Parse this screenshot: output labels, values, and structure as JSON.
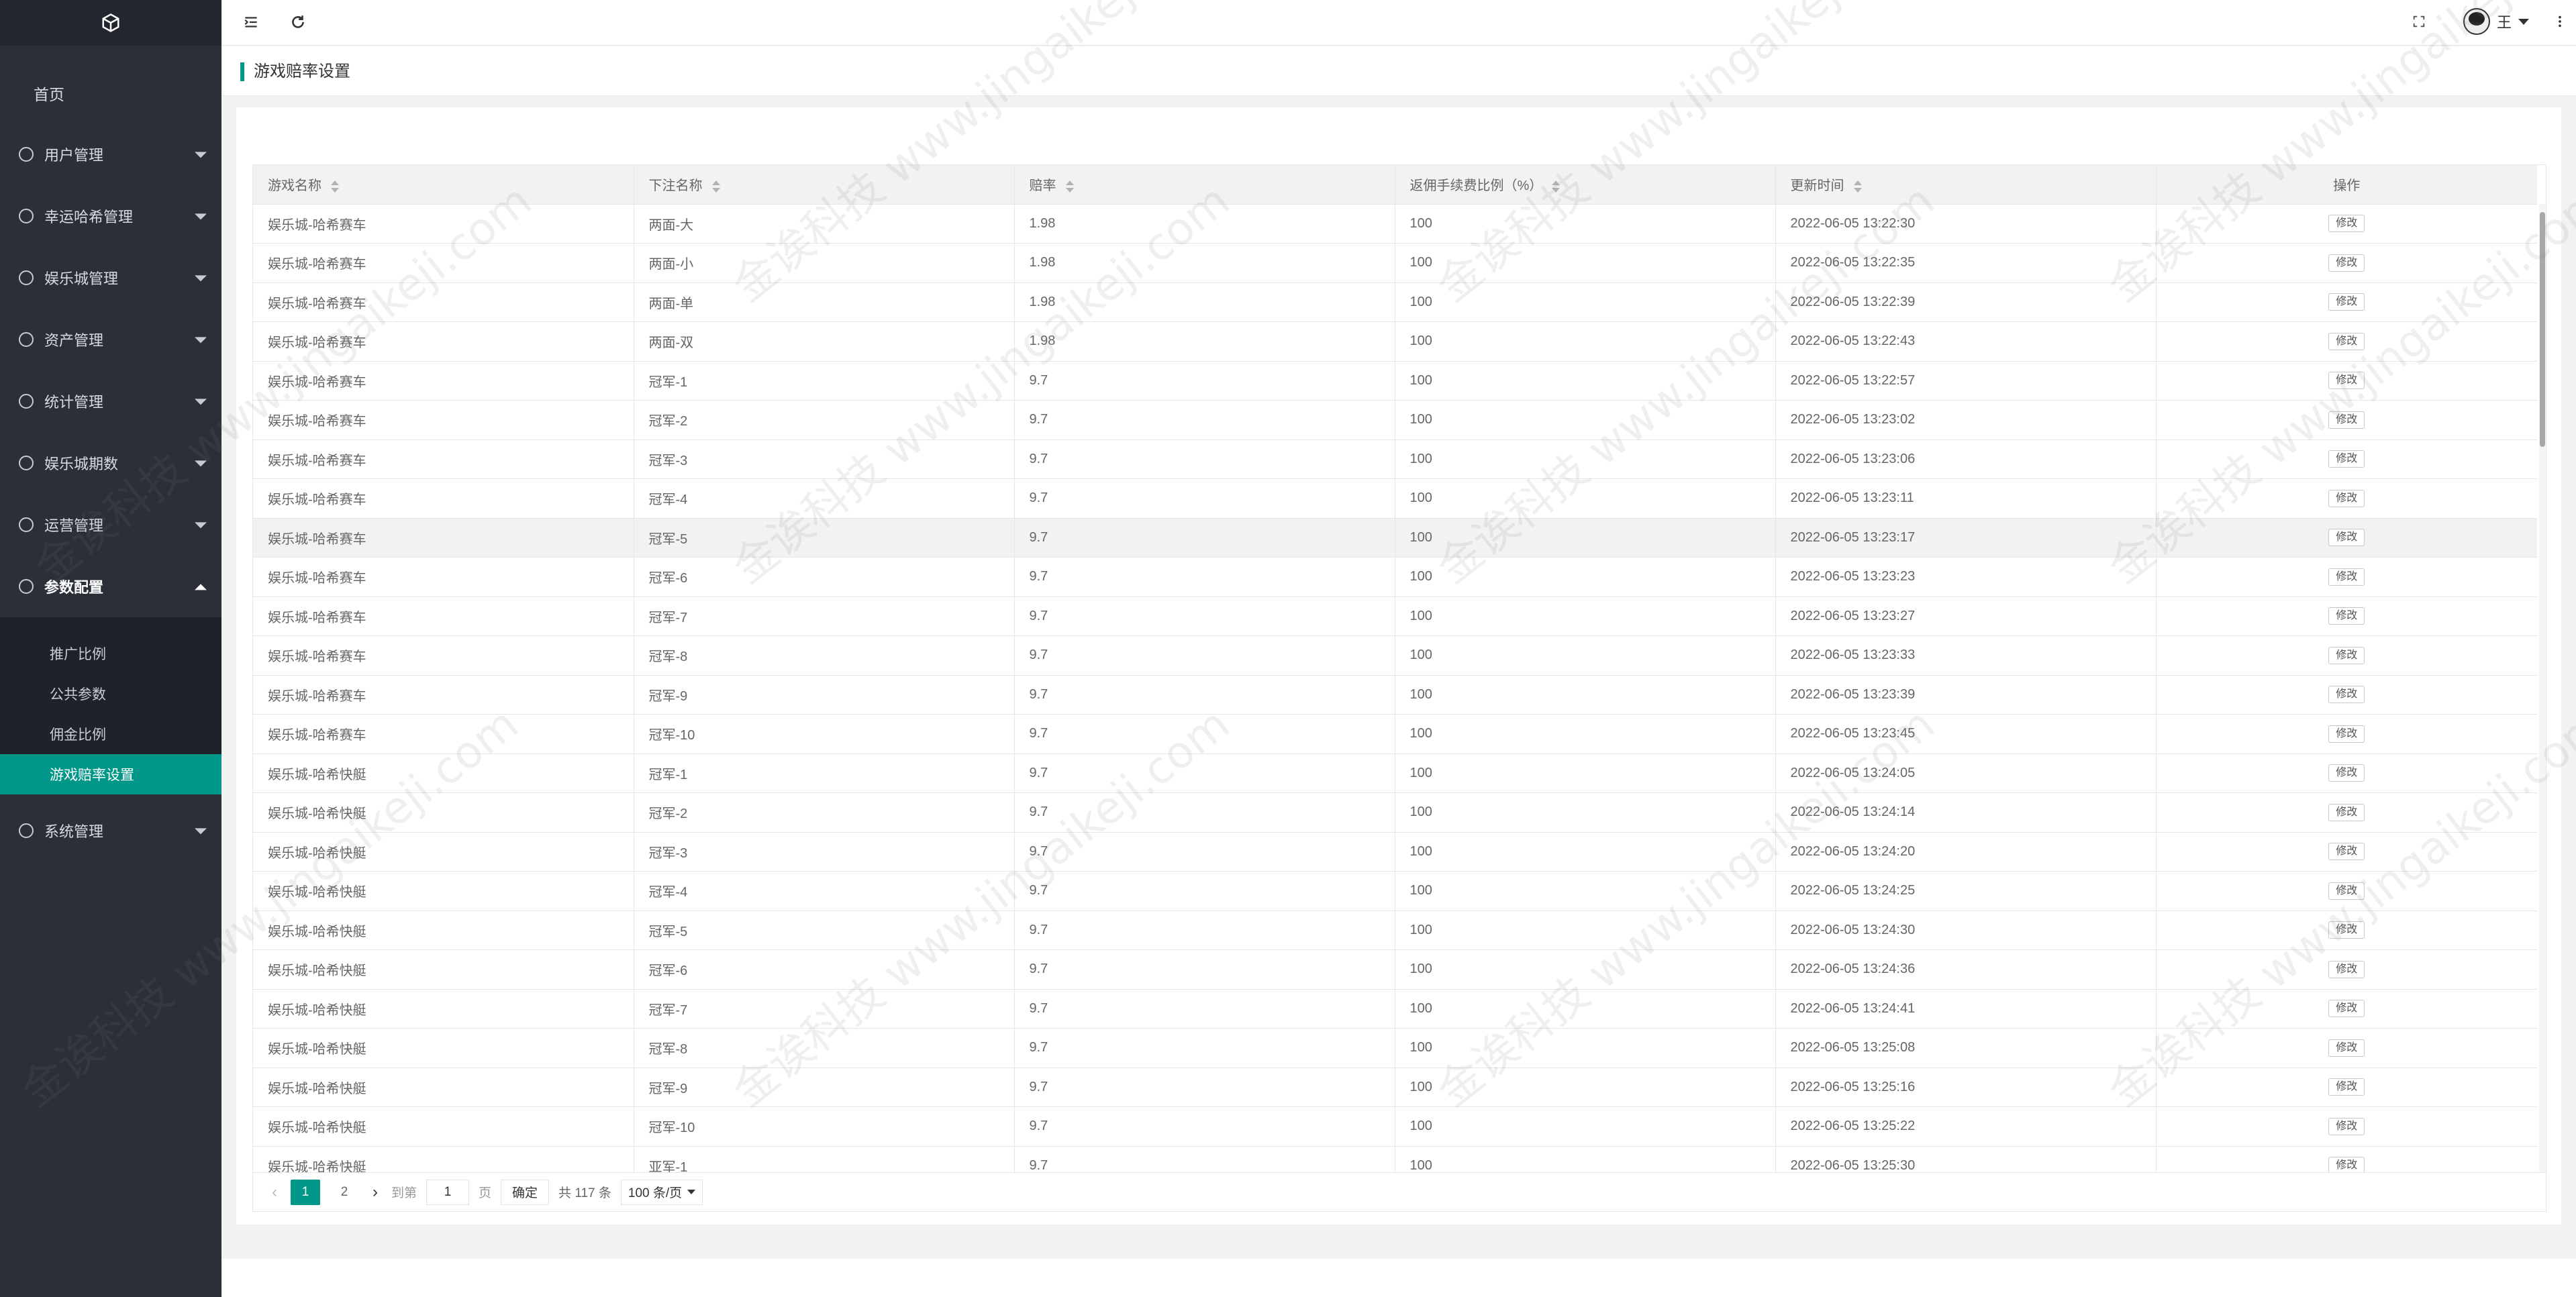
{
  "sidebar": {
    "home": "首页",
    "menus": [
      {
        "label": "用户管理",
        "icon": "user-icon"
      },
      {
        "label": "幸运哈希管理",
        "icon": "circle-dot-icon"
      },
      {
        "label": "娱乐城管理",
        "icon": "circle-dot-icon"
      },
      {
        "label": "资产管理",
        "icon": "circle-dot-icon"
      },
      {
        "label": "统计管理",
        "icon": "gauge-icon"
      },
      {
        "label": "娱乐城期数",
        "icon": "dollar-icon"
      },
      {
        "label": "运营管理",
        "icon": "info-icon"
      },
      {
        "label": "参数配置",
        "icon": "info-icon",
        "open": true
      }
    ],
    "submenu": [
      "推广比例",
      "公共参数",
      "佣金比例",
      "游戏赔率设置"
    ],
    "last_menu": {
      "label": "系统管理",
      "icon": "gear-icon"
    }
  },
  "header": {
    "user_name": "王"
  },
  "breadcrumb": "游戏赔率设置",
  "table": {
    "columns": [
      "游戏名称",
      "下注名称",
      "赔率",
      "返佣手续费比例（%）",
      "更新时间",
      "操作"
    ],
    "edit_label": "修改",
    "rows": [
      [
        "娱乐城-哈希赛车",
        "两面-大",
        "1.98",
        "100",
        "2022-06-05 13:22:30"
      ],
      [
        "娱乐城-哈希赛车",
        "两面-小",
        "1.98",
        "100",
        "2022-06-05 13:22:35"
      ],
      [
        "娱乐城-哈希赛车",
        "两面-单",
        "1.98",
        "100",
        "2022-06-05 13:22:39"
      ],
      [
        "娱乐城-哈希赛车",
        "两面-双",
        "1.98",
        "100",
        "2022-06-05 13:22:43"
      ],
      [
        "娱乐城-哈希赛车",
        "冠军-1",
        "9.7",
        "100",
        "2022-06-05 13:22:57"
      ],
      [
        "娱乐城-哈希赛车",
        "冠军-2",
        "9.7",
        "100",
        "2022-06-05 13:23:02"
      ],
      [
        "娱乐城-哈希赛车",
        "冠军-3",
        "9.7",
        "100",
        "2022-06-05 13:23:06"
      ],
      [
        "娱乐城-哈希赛车",
        "冠军-4",
        "9.7",
        "100",
        "2022-06-05 13:23:11"
      ],
      [
        "娱乐城-哈希赛车",
        "冠军-5",
        "9.7",
        "100",
        "2022-06-05 13:23:17"
      ],
      [
        "娱乐城-哈希赛车",
        "冠军-6",
        "9.7",
        "100",
        "2022-06-05 13:23:23"
      ],
      [
        "娱乐城-哈希赛车",
        "冠军-7",
        "9.7",
        "100",
        "2022-06-05 13:23:27"
      ],
      [
        "娱乐城-哈希赛车",
        "冠军-8",
        "9.7",
        "100",
        "2022-06-05 13:23:33"
      ],
      [
        "娱乐城-哈希赛车",
        "冠军-9",
        "9.7",
        "100",
        "2022-06-05 13:23:39"
      ],
      [
        "娱乐城-哈希赛车",
        "冠军-10",
        "9.7",
        "100",
        "2022-06-05 13:23:45"
      ],
      [
        "娱乐城-哈希快艇",
        "冠军-1",
        "9.7",
        "100",
        "2022-06-05 13:24:05"
      ],
      [
        "娱乐城-哈希快艇",
        "冠军-2",
        "9.7",
        "100",
        "2022-06-05 13:24:14"
      ],
      [
        "娱乐城-哈希快艇",
        "冠军-3",
        "9.7",
        "100",
        "2022-06-05 13:24:20"
      ],
      [
        "娱乐城-哈希快艇",
        "冠军-4",
        "9.7",
        "100",
        "2022-06-05 13:24:25"
      ],
      [
        "娱乐城-哈希快艇",
        "冠军-5",
        "9.7",
        "100",
        "2022-06-05 13:24:30"
      ],
      [
        "娱乐城-哈希快艇",
        "冠军-6",
        "9.7",
        "100",
        "2022-06-05 13:24:36"
      ],
      [
        "娱乐城-哈希快艇",
        "冠军-7",
        "9.7",
        "100",
        "2022-06-05 13:24:41"
      ],
      [
        "娱乐城-哈希快艇",
        "冠军-8",
        "9.7",
        "100",
        "2022-06-05 13:25:08"
      ],
      [
        "娱乐城-哈希快艇",
        "冠军-9",
        "9.7",
        "100",
        "2022-06-05 13:25:16"
      ],
      [
        "娱乐城-哈希快艇",
        "冠军-10",
        "9.7",
        "100",
        "2022-06-05 13:25:22"
      ],
      [
        "娱乐城-哈希快艇",
        "亚军-1",
        "9.7",
        "100",
        "2022-06-05 13:25:30"
      ]
    ]
  },
  "pagination": {
    "current": "1",
    "next_page": "2",
    "goto_label": "到第",
    "goto_value": "1",
    "page_unit": "页",
    "confirm_label": "确定",
    "total": "共 117 条",
    "page_size": "100 条/页"
  },
  "watermark": "金诶科技 www.jingaikeji.com",
  "colors": {
    "accent": "#009688",
    "sidebar_bg": "#2b2f38"
  }
}
